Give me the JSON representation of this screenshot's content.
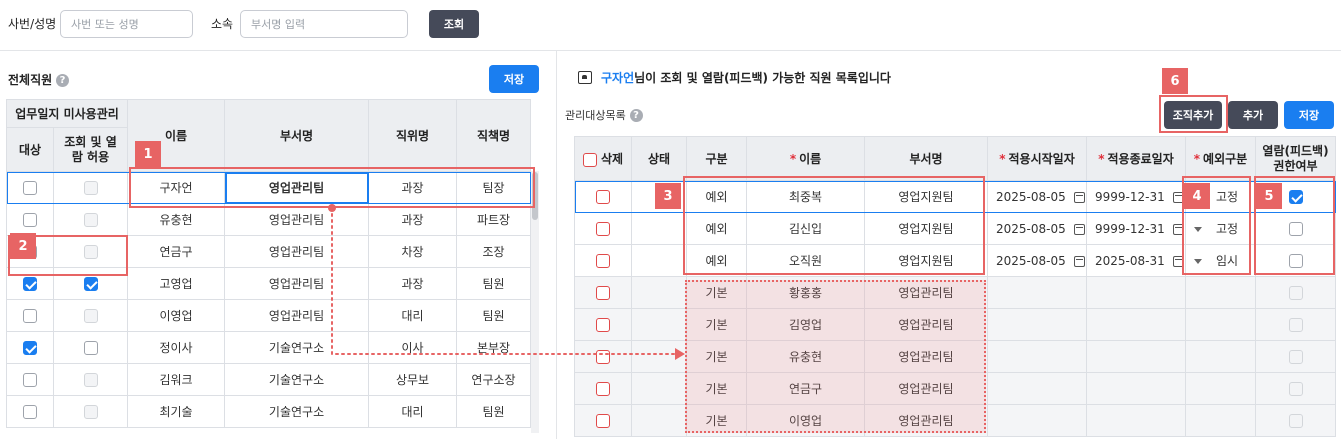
{
  "search": {
    "emp_label": "사번/성명",
    "emp_placeholder": "사번 또는 성명",
    "dept_label": "소속",
    "dept_placeholder": "부서명 입력",
    "search_button": "조회"
  },
  "left": {
    "title": "전체직원",
    "save_button": "저장",
    "group_header": "업무일지 미사용관리",
    "headers": [
      "대상",
      "조회 및 열람 허용",
      "이름",
      "부서명",
      "직위명",
      "직책명"
    ],
    "rows": [
      {
        "target": false,
        "view": false,
        "view_disabled": true,
        "name": "구자언",
        "dept": "영업관리팀",
        "pos": "과장",
        "role": "팀장"
      },
      {
        "target": false,
        "view": false,
        "view_disabled": true,
        "name": "유충현",
        "dept": "영업관리팀",
        "pos": "과장",
        "role": "파트장"
      },
      {
        "target": false,
        "view": false,
        "view_disabled": true,
        "name": "연금구",
        "dept": "영업관리팀",
        "pos": "차장",
        "role": "조장"
      },
      {
        "target": true,
        "view": true,
        "view_disabled": false,
        "name": "고영업",
        "dept": "영업관리팀",
        "pos": "과장",
        "role": "팀원"
      },
      {
        "target": false,
        "view": false,
        "view_disabled": true,
        "name": "이영업",
        "dept": "영업관리팀",
        "pos": "대리",
        "role": "팀원"
      },
      {
        "target": true,
        "view": false,
        "view_disabled": false,
        "name": "정이사",
        "dept": "기술연구소",
        "pos": "이사",
        "role": "본부장"
      },
      {
        "target": false,
        "view": false,
        "view_disabled": true,
        "name": "김워크",
        "dept": "기술연구소",
        "pos": "상무보",
        "role": "연구소장"
      },
      {
        "target": false,
        "view": false,
        "view_disabled": true,
        "name": "최기술",
        "dept": "기술연구소",
        "pos": "대리",
        "role": "팀원"
      }
    ]
  },
  "right": {
    "header_name": "구자언",
    "header_suffix": "님이 조회 및 열람(피드백) 가능한 직원 목록입니다",
    "list_title": "관리대상목록",
    "btn_org_add": "조직추가",
    "btn_add": "추가",
    "btn_save": "저장",
    "headers": [
      "삭제",
      "상태",
      "구분",
      "이름",
      "부서명",
      "적용시작일자",
      "적용종료일자",
      "예외구분",
      "열람(피드백) 권한여부"
    ],
    "rows": [
      {
        "type": "예외",
        "name": "최중복",
        "dept": "영업지원팀",
        "start": "2025-08-05",
        "end": "9999-12-31",
        "exc": "고정",
        "perm": true,
        "kind": "exception"
      },
      {
        "type": "예외",
        "name": "김신입",
        "dept": "영업지원팀",
        "start": "2025-08-05",
        "end": "9999-12-31",
        "exc": "고정",
        "perm": false,
        "kind": "exception"
      },
      {
        "type": "예외",
        "name": "오직원",
        "dept": "영업지원팀",
        "start": "2025-08-05",
        "end": "2025-08-31",
        "exc": "임시",
        "perm": false,
        "kind": "exception"
      },
      {
        "type": "기본",
        "name": "황홍홍",
        "dept": "영업관리팀",
        "start": "",
        "end": "",
        "exc": "",
        "perm": false,
        "kind": "basic"
      },
      {
        "type": "기본",
        "name": "김영업",
        "dept": "영업관리팀",
        "start": "",
        "end": "",
        "exc": "",
        "perm": false,
        "kind": "basic"
      },
      {
        "type": "기본",
        "name": "유충현",
        "dept": "영업관리팀",
        "start": "",
        "end": "",
        "exc": "",
        "perm": false,
        "kind": "basic"
      },
      {
        "type": "기본",
        "name": "연금구",
        "dept": "영업관리팀",
        "start": "",
        "end": "",
        "exc": "",
        "perm": false,
        "kind": "basic"
      },
      {
        "type": "기본",
        "name": "이영업",
        "dept": "영업관리팀",
        "start": "",
        "end": "",
        "exc": "",
        "perm": false,
        "kind": "basic"
      }
    ]
  },
  "annotations": [
    "1",
    "2",
    "3",
    "4",
    "5",
    "6"
  ],
  "colors": {
    "accent": "#1a7ef0",
    "dark_button": "#454a59",
    "highlight": "#e76464",
    "required": "#e0303b"
  }
}
